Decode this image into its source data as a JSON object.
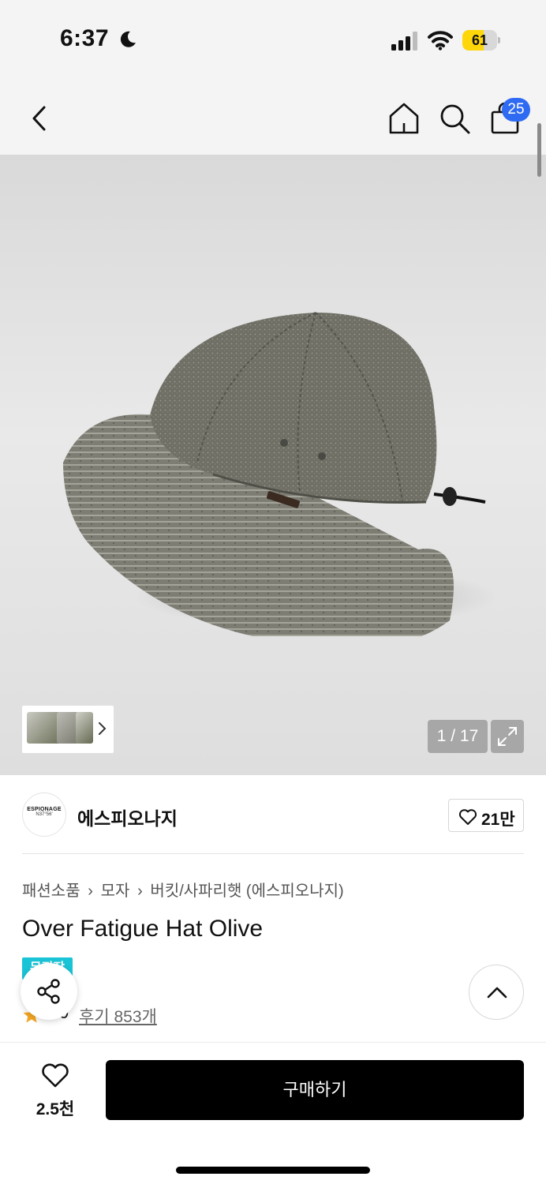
{
  "status_bar": {
    "time": "6:37",
    "battery": "61",
    "battery_level": 0.61
  },
  "top_nav": {
    "cart_count": "25",
    "icons": [
      "back-arrow-icon",
      "home-icon",
      "search-icon",
      "cart-bag-icon"
    ]
  },
  "gallery": {
    "counter": "1 / 17",
    "current": 1,
    "total": 17
  },
  "brand": {
    "logo_text": "ESPIONAGE",
    "logo_sub": "N37°56'",
    "name": "에스피오나지",
    "like_count": "21만"
  },
  "breadcrumb": {
    "items": [
      "패션소품",
      "모자",
      "버킷/사파리햇 (에스피오나지)"
    ]
  },
  "product": {
    "title": "Over Fatigue Hat Olive",
    "badge": "무진장",
    "rating": "4.9",
    "review_label": "후기 853개"
  },
  "bottom_bar": {
    "like_count": "2.5천",
    "buy_label": "구매하기"
  },
  "colors": {
    "accent_blue": "#2f6bf2",
    "badge_cyan": "#19c4d6",
    "star_orange": "#f5a623",
    "battery_yellow": "#ffd60a",
    "buy_black": "#000000"
  }
}
